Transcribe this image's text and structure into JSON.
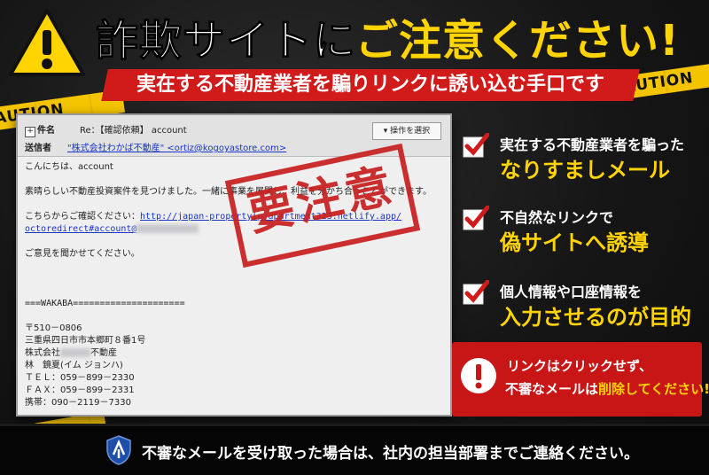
{
  "header": {
    "title_white": "詐欺サイトに",
    "title_yellow": "ご注意ください!",
    "subtitle": "実在する不動産業者を騙りリンクに誘い込む手口です"
  },
  "tape_text": "CAUTION",
  "email": {
    "subject_label": "件名",
    "subject_value": "Re：【確認依頼】 account",
    "sender_label": "送信者",
    "sender_value": "\"株式会社わかば不動産\" <ortiz@kogoyastore.com>",
    "operation_button": "▾ 操作を選択",
    "greeting": "こんにちは、account",
    "body1": "素晴らしい不動産投資案件を見つけました。一緒に事業を展開し、利益を分かち合うことができます。",
    "confirm_prefix": "こちらからご確認ください：",
    "confirm_link": "http://japan-propertyip-apartment323.netlify.app/",
    "link_line2": "octoredirect#account@",
    "closing": "ご意見を聞かせてください。",
    "sig_sep": "===WAKABA=====================",
    "postal": "〒510－0806",
    "address": "三重県四日市市本郷町８番1号",
    "company_prefix": "株式会社",
    "company_suffix": "不動産",
    "person": "林　鏡夏(イム ジョンハ)",
    "tel": "ＴＥＬ：059－899－2330",
    "fax": "ＦＡＸ：059－899－2331",
    "mobile": "携帯：090－2119－7330"
  },
  "stamp": "要注意",
  "points": [
    {
      "line1": "実在する不動産業者を騙った",
      "line2": "なりすましメール"
    },
    {
      "line1": "不自然なリンクで",
      "line2": "偽サイトへ誘導"
    },
    {
      "line1": "個人情報や口座情報を",
      "line2": "入力させるのが目的"
    }
  ],
  "alert": {
    "line1": "リンクはクリックせず、",
    "line2_prefix": "不審なメールは",
    "line2_highlight": "削除してください!"
  },
  "footer": {
    "text": "不審なメールを受け取った場合は、社内の担当部署までご連絡ください。"
  },
  "colors": {
    "accent_red": "#d11b1b",
    "accent_yellow": "#ffd400",
    "tape_yellow": "#f5c400",
    "link_blue": "#1b35c6"
  },
  "icons": [
    "warning-triangle-icon",
    "check-icon",
    "exclamation-icon",
    "shield-icon"
  ]
}
